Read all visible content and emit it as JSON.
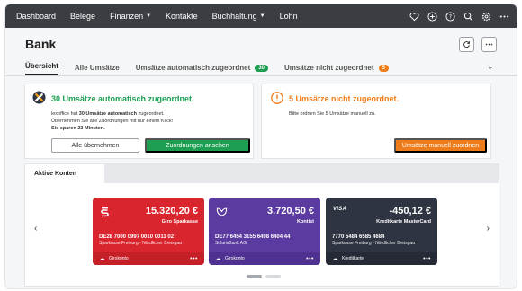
{
  "nav": {
    "items": [
      {
        "label": "Dashboard",
        "dropdown": false
      },
      {
        "label": "Belege",
        "dropdown": false
      },
      {
        "label": "Finanzen",
        "dropdown": true
      },
      {
        "label": "Kontakte",
        "dropdown": false
      },
      {
        "label": "Buchhaltung",
        "dropdown": true
      },
      {
        "label": "Lohn",
        "dropdown": false
      }
    ],
    "icons": [
      "heart-icon",
      "plus-circle-icon",
      "help-icon",
      "search-icon",
      "gear-icon",
      "more-icon"
    ]
  },
  "header": {
    "title": "Bank",
    "refresh_icon": "refresh-icon",
    "more_icon": "more-icon"
  },
  "tabs": [
    {
      "label": "Übersicht",
      "active": true,
      "badge": null
    },
    {
      "label": "Alle Umsätze",
      "active": false,
      "badge": null
    },
    {
      "label": "Umsätze automatisch zugeordnet",
      "active": false,
      "badge": "30",
      "badge_color": "#1d9e51"
    },
    {
      "label": "Umsätze nicht zugeordnet",
      "active": false,
      "badge": "5",
      "badge_color": "#ee7c1a"
    }
  ],
  "auto_panel": {
    "title": "30 Umsätze automatisch zugeordnet.",
    "line1_prefix": "lexoffice hat ",
    "line1_bold": "30 Umsätze automatisch",
    "line1_suffix": " zugeordnet.",
    "line2": "Übernehmen Sie alle Zuordnungen mit nur einem Klick!",
    "line3": "Sie sparen 23 Minuten.",
    "btn_secondary": "Alle übernehmen",
    "btn_primary": "Zuordnungen ansehen",
    "title_color": "#1d9e51"
  },
  "manual_panel": {
    "title": "5 Umsätze nicht zugeordnet.",
    "text": "Bitte ordnen Sie 5 Umsätze manuell zu.",
    "btn_primary": "Umsätze manuell zuordnen",
    "title_color": "#ee7c1a"
  },
  "accounts": {
    "tab_label": "Aktive Konten",
    "cards": [
      {
        "amount": "15.320,20 €",
        "bank": "Giro Sparkasse",
        "iban": "DE28 7000 0997 0010 0011 02",
        "holder": "Sparkasse Freiburg - Nördlicher Breisgau",
        "type": "Girokonto",
        "color": "#d9252e",
        "logo": "sparkasse-logo"
      },
      {
        "amount": "3.720,50 €",
        "bank": "Kontist",
        "iban": "DE77 6454 3155 6498 6404 44",
        "holder": "SolarisBank AG",
        "type": "Girokonto",
        "color": "#5b3ba0",
        "logo": "leaf-logo"
      },
      {
        "amount": "-450,12 €",
        "bank": "Kreditkarte MasterCard",
        "iban": "7770 5484 6585 4684",
        "holder": "Sparkasse Freiburg - Nördlicher Breisgau",
        "type": "Kreditkarte",
        "color": "#2e3442",
        "logo": "VISA"
      }
    ],
    "pager": {
      "pages": 2,
      "active": 0
    }
  }
}
